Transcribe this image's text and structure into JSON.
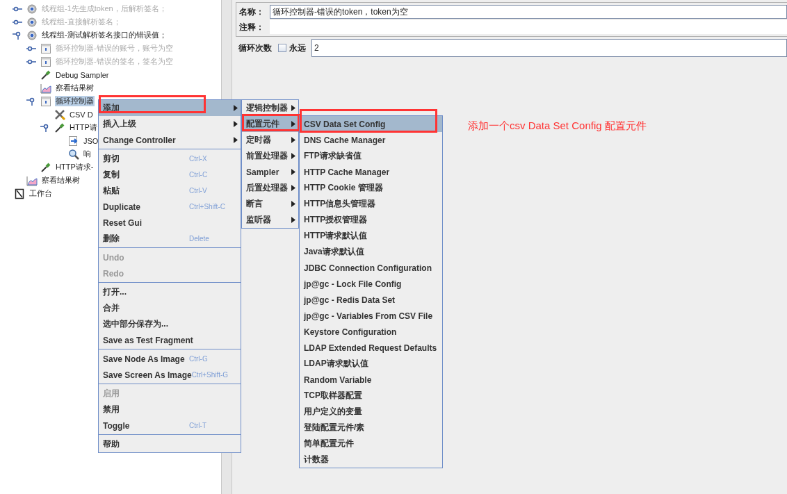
{
  "tree": {
    "items": [
      {
        "label": "线程组-1先生成token，后解析签名；",
        "kind": "thread-group",
        "disabled": true,
        "selected": false,
        "expanded": false
      },
      {
        "label": "线程组-直接解析签名；",
        "kind": "thread-group",
        "disabled": true,
        "selected": false,
        "expanded": false
      },
      {
        "label": "线程组-测试解析签名接口的错误值；",
        "kind": "thread-group",
        "disabled": false,
        "selected": false,
        "expanded": true,
        "children": [
          {
            "label": "循环控制器-错误的账号，账号为空",
            "kind": "loop",
            "disabled": true,
            "selected": false,
            "expanded": false
          },
          {
            "label": "循环控制器-错误的签名，签名为空",
            "kind": "loop",
            "disabled": true,
            "selected": false,
            "expanded": false
          },
          {
            "label": "Debug Sampler",
            "kind": "sampler",
            "disabled": false,
            "selected": false
          },
          {
            "label": "察看结果树",
            "kind": "listener",
            "disabled": false,
            "selected": false
          },
          {
            "label": "循环控制器",
            "kind": "loop",
            "disabled": false,
            "selected": true,
            "expanded": true,
            "children": [
              {
                "label": "CSV D",
                "kind": "config",
                "disabled": false,
                "selected": false
              },
              {
                "label": "HTTP请",
                "kind": "sampler",
                "disabled": false,
                "selected": false,
                "expanded": true,
                "children": [
                  {
                    "label": "JSO",
                    "kind": "extractor",
                    "disabled": false,
                    "selected": false
                  },
                  {
                    "label": "响",
                    "kind": "assertion",
                    "disabled": false,
                    "selected": false
                  }
                ]
              }
            ]
          },
          {
            "label": "HTTP请求-",
            "kind": "sampler",
            "disabled": false,
            "selected": false
          }
        ]
      },
      {
        "label": "察看结果树",
        "kind": "listener",
        "disabled": false,
        "selected": false
      }
    ],
    "workbench": {
      "label": "工作台",
      "kind": "workbench"
    }
  },
  "form": {
    "name_label": "名称：",
    "name_value": "循环控制器-错误的token，token为空",
    "comment_label": "注释：",
    "loop_label": "循环次数",
    "forever": {
      "label": "永远",
      "checked": false
    },
    "loop_count": "2"
  },
  "context_menu": {
    "items": [
      {
        "kind": "item",
        "label": "添加",
        "submenu": true,
        "selected": true,
        "disabled": false,
        "highlighted": true
      },
      {
        "kind": "item",
        "label": "插入上级",
        "submenu": true,
        "selected": false,
        "disabled": false,
        "highlighted": false
      },
      {
        "kind": "item",
        "label": "Change Controller",
        "submenu": true,
        "selected": false,
        "disabled": false,
        "highlighted": false
      },
      {
        "kind": "separator"
      },
      {
        "kind": "item",
        "label": "剪切",
        "shortcut": "Ctrl-X",
        "submenu": false,
        "selected": false,
        "disabled": false,
        "highlighted": false
      },
      {
        "kind": "item",
        "label": "复制",
        "shortcut": "Ctrl-C",
        "submenu": false,
        "selected": false,
        "disabled": false,
        "highlighted": false
      },
      {
        "kind": "item",
        "label": "粘贴",
        "shortcut": "Ctrl-V",
        "submenu": false,
        "selected": false,
        "disabled": false,
        "highlighted": false
      },
      {
        "kind": "item",
        "label": "Duplicate",
        "shortcut": "Ctrl+Shift-C",
        "submenu": false,
        "selected": false,
        "disabled": false,
        "highlighted": false
      },
      {
        "kind": "item",
        "label": "Reset Gui",
        "submenu": false,
        "selected": false,
        "disabled": false,
        "highlighted": false
      },
      {
        "kind": "item",
        "label": "删除",
        "shortcut": "Delete",
        "submenu": false,
        "selected": false,
        "disabled": false,
        "highlighted": false
      },
      {
        "kind": "separator"
      },
      {
        "kind": "item",
        "label": "Undo",
        "submenu": false,
        "selected": false,
        "disabled": true,
        "highlighted": false
      },
      {
        "kind": "item",
        "label": "Redo",
        "submenu": false,
        "selected": false,
        "disabled": true,
        "highlighted": false
      },
      {
        "kind": "separator"
      },
      {
        "kind": "item",
        "label": "打开...",
        "submenu": false,
        "selected": false,
        "disabled": false,
        "highlighted": false
      },
      {
        "kind": "item",
        "label": "合并",
        "submenu": false,
        "selected": false,
        "disabled": false,
        "highlighted": false
      },
      {
        "kind": "item",
        "label": "选中部分保存为...",
        "submenu": false,
        "selected": false,
        "disabled": false,
        "highlighted": false
      },
      {
        "kind": "item",
        "label": "Save as Test Fragment",
        "submenu": false,
        "selected": false,
        "disabled": false,
        "highlighted": false
      },
      {
        "kind": "separator"
      },
      {
        "kind": "item",
        "label": "Save Node As Image",
        "shortcut": "Ctrl-G",
        "submenu": false,
        "selected": false,
        "disabled": false,
        "highlighted": false
      },
      {
        "kind": "item",
        "label": "Save Screen As Image",
        "shortcut": "Ctrl+Shift-G",
        "submenu": false,
        "selected": false,
        "disabled": false,
        "highlighted": false
      },
      {
        "kind": "separator"
      },
      {
        "kind": "item",
        "label": "启用",
        "submenu": false,
        "selected": false,
        "disabled": true,
        "highlighted": false
      },
      {
        "kind": "item",
        "label": "禁用",
        "submenu": false,
        "selected": false,
        "disabled": false,
        "highlighted": false
      },
      {
        "kind": "item",
        "label": "Toggle",
        "shortcut": "Ctrl-T",
        "submenu": false,
        "selected": false,
        "disabled": false,
        "highlighted": false
      },
      {
        "kind": "separator"
      },
      {
        "kind": "item",
        "label": "帮助",
        "submenu": false,
        "selected": false,
        "disabled": false,
        "highlighted": false
      }
    ]
  },
  "add_submenu": {
    "items": [
      {
        "kind": "item",
        "label": "逻辑控制器",
        "submenu": true,
        "selected": false,
        "disabled": false,
        "highlighted": false
      },
      {
        "kind": "item",
        "label": "配置元件",
        "submenu": true,
        "selected": true,
        "disabled": false,
        "highlighted": true
      },
      {
        "kind": "item",
        "label": "定时器",
        "submenu": true,
        "selected": false,
        "disabled": false,
        "highlighted": false
      },
      {
        "kind": "item",
        "label": "前置处理器",
        "submenu": true,
        "selected": false,
        "disabled": false,
        "highlighted": false
      },
      {
        "kind": "item",
        "label": "Sampler",
        "submenu": true,
        "selected": false,
        "disabled": false,
        "highlighted": false
      },
      {
        "kind": "item",
        "label": "后置处理器",
        "submenu": true,
        "selected": false,
        "disabled": false,
        "highlighted": false
      },
      {
        "kind": "item",
        "label": "断言",
        "submenu": true,
        "selected": false,
        "disabled": false,
        "highlighted": false
      },
      {
        "kind": "item",
        "label": "监听器",
        "submenu": true,
        "selected": false,
        "disabled": false,
        "highlighted": false
      }
    ]
  },
  "config_submenu": {
    "items": [
      {
        "kind": "item",
        "label": "CSV Data Set Config",
        "submenu": false,
        "selected": true,
        "disabled": false,
        "highlighted": true
      },
      {
        "kind": "item",
        "label": "DNS Cache Manager",
        "submenu": false,
        "selected": false,
        "disabled": false,
        "highlighted": false
      },
      {
        "kind": "item",
        "label": "FTP请求缺省值",
        "submenu": false,
        "selected": false,
        "disabled": false,
        "highlighted": false
      },
      {
        "kind": "item",
        "label": "HTTP Cache Manager",
        "submenu": false,
        "selected": false,
        "disabled": false,
        "highlighted": false
      },
      {
        "kind": "item",
        "label": "HTTP Cookie 管理器",
        "submenu": false,
        "selected": false,
        "disabled": false,
        "highlighted": false
      },
      {
        "kind": "item",
        "label": "HTTP信息头管理器",
        "submenu": false,
        "selected": false,
        "disabled": false,
        "highlighted": false
      },
      {
        "kind": "item",
        "label": "HTTP授权管理器",
        "submenu": false,
        "selected": false,
        "disabled": false,
        "highlighted": false
      },
      {
        "kind": "item",
        "label": "HTTP请求默认值",
        "submenu": false,
        "selected": false,
        "disabled": false,
        "highlighted": false
      },
      {
        "kind": "item",
        "label": "Java请求默认值",
        "submenu": false,
        "selected": false,
        "disabled": false,
        "highlighted": false
      },
      {
        "kind": "item",
        "label": "JDBC Connection Configuration",
        "submenu": false,
        "selected": false,
        "disabled": false,
        "highlighted": false
      },
      {
        "kind": "item",
        "label": "jp@gc - Lock File Config",
        "submenu": false,
        "selected": false,
        "disabled": false,
        "highlighted": false
      },
      {
        "kind": "item",
        "label": "jp@gc - Redis Data Set",
        "submenu": false,
        "selected": false,
        "disabled": false,
        "highlighted": false
      },
      {
        "kind": "item",
        "label": "jp@gc - Variables From CSV File",
        "submenu": false,
        "selected": false,
        "disabled": false,
        "highlighted": false
      },
      {
        "kind": "item",
        "label": "Keystore Configuration",
        "submenu": false,
        "selected": false,
        "disabled": false,
        "highlighted": false
      },
      {
        "kind": "item",
        "label": "LDAP Extended Request Defaults",
        "submenu": false,
        "selected": false,
        "disabled": false,
        "highlighted": false
      },
      {
        "kind": "item",
        "label": "LDAP请求默认值",
        "submenu": false,
        "selected": false,
        "disabled": false,
        "highlighted": false
      },
      {
        "kind": "item",
        "label": "Random Variable",
        "submenu": false,
        "selected": false,
        "disabled": false,
        "highlighted": false
      },
      {
        "kind": "item",
        "label": "TCP取样器配置",
        "submenu": false,
        "selected": false,
        "disabled": false,
        "highlighted": false
      },
      {
        "kind": "item",
        "label": "用户定义的变量",
        "submenu": false,
        "selected": false,
        "disabled": false,
        "highlighted": false
      },
      {
        "kind": "item",
        "label": "登陆配置元件/素",
        "submenu": false,
        "selected": false,
        "disabled": false,
        "highlighted": false
      },
      {
        "kind": "item",
        "label": "简单配置元件",
        "submenu": false,
        "selected": false,
        "disabled": false,
        "highlighted": false
      },
      {
        "kind": "item",
        "label": "计数器",
        "submenu": false,
        "selected": false,
        "disabled": false,
        "highlighted": false
      }
    ]
  },
  "annotation": "添加一个csv Data Set Config 配置元件"
}
